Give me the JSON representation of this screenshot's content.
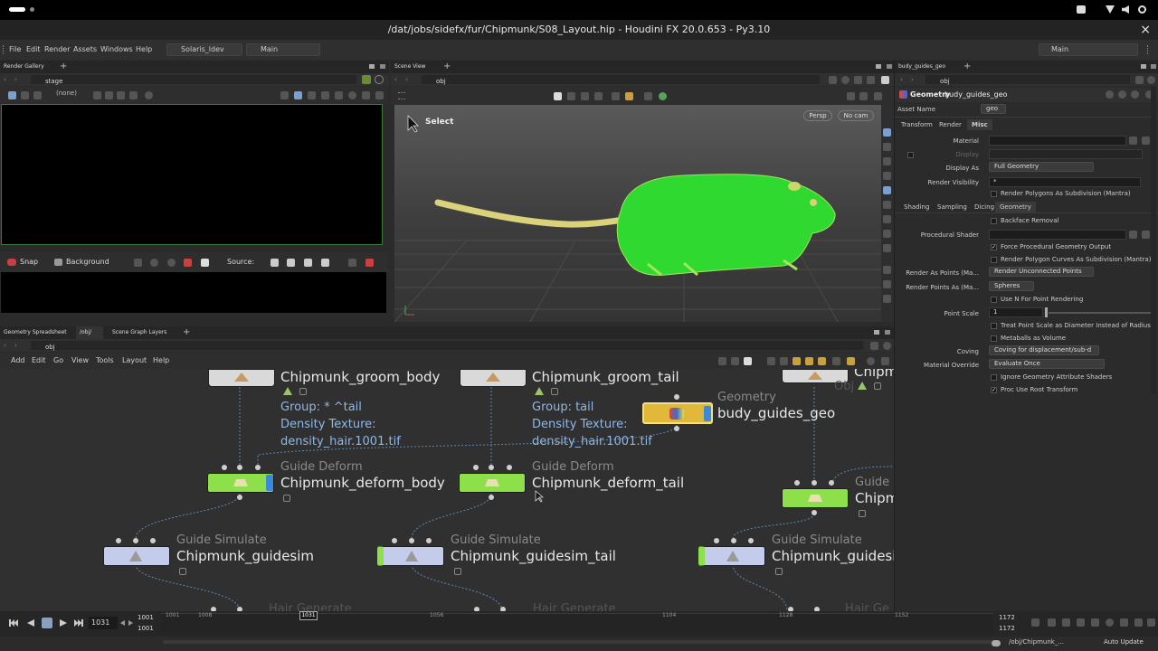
{
  "titlebar": {
    "title": "/dat/jobs/sidefx/fur/Chipmunk/S08_Layout.hip - Houdini FX 20.0.653 - Py3.10",
    "close": "×"
  },
  "menu": {
    "items": [
      "File",
      "Edit",
      "Render",
      "Assets",
      "Windows",
      "Help"
    ],
    "desktop": "Solaris_ldev",
    "main_left": "Main",
    "main_right": "Main"
  },
  "render_gallery": {
    "tab": "Render Gallery",
    "path": "stage",
    "none_label": "(none)",
    "snap": "Snap",
    "background": "Background",
    "source": "Source:"
  },
  "scene_view": {
    "tab": "Scene View",
    "path": "obj",
    "select": "Select",
    "persp": "Persp",
    "nocam": "No cam"
  },
  "network": {
    "tabs": [
      "Geometry Spreadsheet",
      "/obj/",
      "Scene Graph Layers"
    ],
    "path": "obj",
    "menu": [
      "Add",
      "Edit",
      "Go",
      "View",
      "Tools",
      "Layout",
      "Help"
    ],
    "nodes": {
      "groom_body": {
        "name": "Chipmunk_groom_body",
        "comment": [
          "Group: * ^tail",
          "Density Texture:",
          "density_hair.1001.tif"
        ]
      },
      "groom_tail": {
        "name": "Chipmunk_groom_tail",
        "comment": [
          "Group: tail",
          "Density Texture:",
          "density_hair.1001.tif"
        ]
      },
      "guides_geo": {
        "type": "Geometry",
        "name": "budy_guides_geo"
      },
      "groom_third": {
        "name": "Chipm",
        "type": "Obj"
      },
      "deform_body": {
        "type": "Guide Deform",
        "name": "Chipmunk_deform_body"
      },
      "deform_tail": {
        "type": "Guide Deform",
        "name": "Chipmunk_deform_tail"
      },
      "deform_third": {
        "type": "Guide I",
        "name": "Chipm"
      },
      "sim_body": {
        "type": "Guide Simulate",
        "name": "Chipmunk_guidesim"
      },
      "sim_tail": {
        "type": "Guide Simulate",
        "name": "Chipmunk_guidesim_tail"
      },
      "sim_third": {
        "type": "Guide Simulate",
        "name": "Chipmunk_guidesir"
      },
      "hair_gen_1": {
        "type": "Hair Generate"
      },
      "hair_gen_2": {
        "type": "Hair Generate"
      },
      "hair_gen_3": {
        "type": "Hair Ge"
      }
    }
  },
  "params": {
    "tab": "budy_guides_geo",
    "path": "obj",
    "node_type": "Geometry",
    "node_name": "budy_guides_geo",
    "asset_name_label": "Asset Name",
    "asset_name_value": "geo",
    "tabs": [
      "Transform",
      "Render",
      "Misc"
    ],
    "rows": {
      "material": "Material",
      "display": "Display",
      "display_as": "Display As",
      "display_as_val": "Full Geometry",
      "render_vis": "Render Visibility",
      "render_vis_val": "*",
      "polys_subdiv": "Render Polygons As Subdivision (Mantra)"
    },
    "subtabs": [
      "Shading",
      "Sampling",
      "Dicing",
      "Geometry"
    ],
    "geom": {
      "backface": "Backface Removal",
      "proc_shader": "Procedural Shader",
      "force_proc": "Force Procedural Geometry Output",
      "curves_subdiv": "Render Polygon Curves As Subdivision (Mantra)",
      "points_as": "Render As Points (Ma...",
      "points_as_val": "Render Unconnected Points",
      "points_mode": "Render Points As (Ma...",
      "points_mode_val": "Spheres",
      "use_n": "Use N For Point Rendering",
      "point_scale": "Point Scale",
      "point_scale_val": "1",
      "treat_scale": "Treat Point Scale as Diameter Instead of Radius",
      "metaballs": "Metaballs as Volume",
      "coving": "Coving",
      "coving_val": "Coving for displacement/sub-d",
      "mat_override": "Material Override",
      "mat_override_val": "Evaluate Once",
      "ignore_attr": "Ignore Geometry Attribute Shaders",
      "proc_root": "Proc Use Root Transform"
    }
  },
  "timeline": {
    "frame": "1031",
    "start": "1001",
    "start2": "1001",
    "end": "1172",
    "end2": "1172",
    "ticks": [
      "1001",
      "1008",
      "1031",
      "1056",
      "1104",
      "1128",
      "1152"
    ],
    "cur": "1031",
    "auto_update": "Auto Update",
    "obj_path": "/obj/Chipmunk_..."
  }
}
